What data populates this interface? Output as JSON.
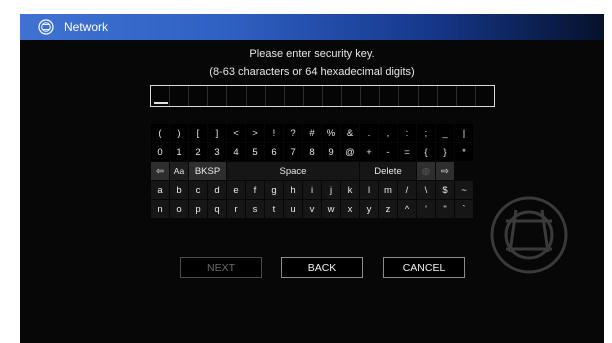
{
  "title_bar": {
    "icon": "network-globe-icon",
    "title": "Network"
  },
  "instructions": {
    "line1": "Please enter security key.",
    "line2": "(8-63 characters or 64 hexadecimal digits)"
  },
  "key_input": {
    "value": ""
  },
  "keyboard": {
    "row1": [
      "(",
      ")",
      "[",
      "]",
      "<",
      ">",
      "!",
      "?",
      "#",
      "%",
      "&",
      ".",
      ",",
      ":",
      ";",
      "_",
      "|"
    ],
    "row2": [
      "0",
      "1",
      "2",
      "3",
      "4",
      "5",
      "6",
      "7",
      "8",
      "9",
      "@",
      "+",
      "-",
      "=",
      "{",
      "}",
      "*"
    ],
    "row3": {
      "left_arrow": "⇦",
      "case": "Aa",
      "backspace": "BKSP",
      "space": "Space",
      "delete": "Delete",
      "globe": "◍",
      "right_arrow": "⇨"
    },
    "row4": [
      "a",
      "b",
      "c",
      "d",
      "e",
      "f",
      "g",
      "h",
      "i",
      "j",
      "k",
      "l",
      "m",
      "/",
      "\\",
      "$",
      "~"
    ],
    "row5": [
      "n",
      "o",
      "p",
      "q",
      "r",
      "s",
      "t",
      "u",
      "v",
      "w",
      "x",
      "y",
      "z",
      "^",
      "'",
      "\"",
      "`"
    ]
  },
  "buttons": {
    "next": "NEXT",
    "back": "BACK",
    "cancel": "CANCEL"
  }
}
